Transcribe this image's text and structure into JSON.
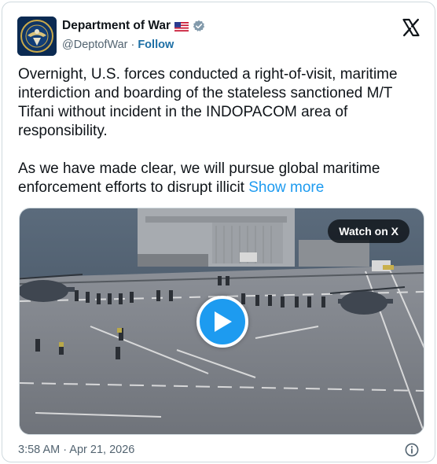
{
  "author": {
    "display_name": "Department of War",
    "handle": "@DeptofWar",
    "separator": "·",
    "follow_label": "Follow",
    "flag_icon": "us-flag-icon",
    "verified_icon": "verified-badge-icon"
  },
  "tweet": {
    "paragraph_1": "Overnight, U.S. forces conducted a right-of-visit, maritime interdiction and boarding of the stateless sanctioned M/T Tifani without incident in the INDOPACOM area of responsibility.",
    "paragraph_2": "As we have made clear, we will pursue global maritime enforcement efforts to disrupt illicit",
    "show_more_label": "Show more"
  },
  "media": {
    "watch_label": "Watch on X",
    "play_icon": "play-icon"
  },
  "footer": {
    "timestamp": "3:58 AM · Apr 21, 2026",
    "info_icon": "info-icon"
  },
  "colors": {
    "link": "#1d9bf0",
    "follow": "#1d6fa5",
    "muted": "#536471",
    "play_button": "#1d9bf0"
  }
}
